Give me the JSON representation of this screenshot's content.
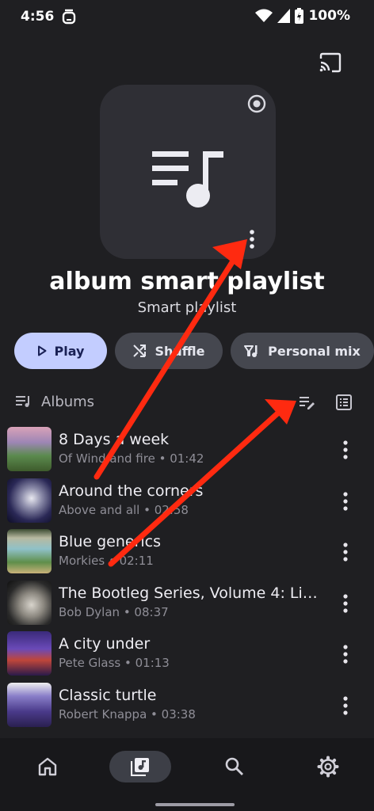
{
  "status_bar": {
    "time": "4:56",
    "battery": "100%"
  },
  "playlist": {
    "title": "album smart playlist",
    "subtitle": "Smart playlist"
  },
  "actions": {
    "play": "Play",
    "shuffle": "Shuffle",
    "mix": "Personal mix"
  },
  "section": {
    "label": "Albums"
  },
  "tracks": [
    {
      "title": "8 Days a week",
      "subtitle": "Of Wind and fire • 01:42"
    },
    {
      "title": "Around the corners",
      "subtitle": "Above and all • 02:58"
    },
    {
      "title": "Blue generics",
      "subtitle": "Morkies • 02:11"
    },
    {
      "title": "The Bootleg Series, Volume 4: Live...",
      "subtitle": "Bob Dylan • 08:37"
    },
    {
      "title": "A city under",
      "subtitle": "Pete Glass • 01:13"
    },
    {
      "title": "Classic turtle",
      "subtitle": "Robert Knappa • 03:38"
    }
  ],
  "colors": {
    "accent": "#c3cdff",
    "annotation": "#ff2a10",
    "background": "#1f1f22"
  },
  "icons": [
    "alarm-icon",
    "wifi-icon",
    "signal-icon",
    "battery-icon",
    "cast-icon",
    "album-badge-icon",
    "playlist-note-icon",
    "more-vert-icon",
    "play-icon",
    "shuffle-icon",
    "mix-icon",
    "playlist-edit-icon",
    "list-view-icon",
    "home-icon",
    "library-icon",
    "search-icon",
    "settings-icon"
  ]
}
